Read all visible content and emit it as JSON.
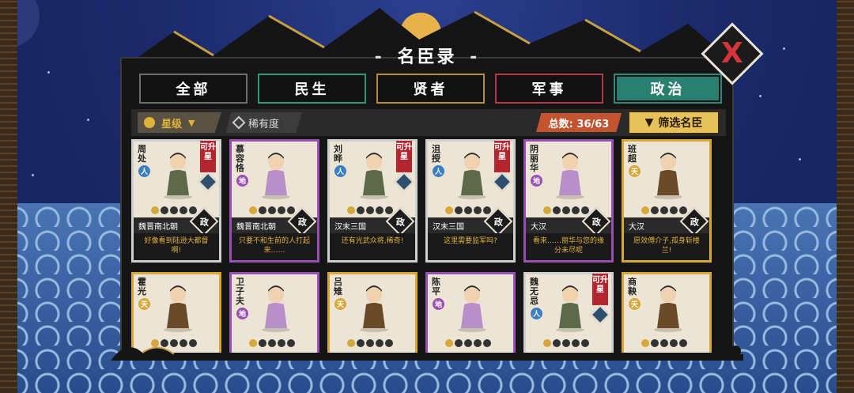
{
  "title": "名臣录",
  "title_dashes": [
    "-",
    "-"
  ],
  "close_label": "X",
  "tabs": [
    {
      "label": "全部",
      "kind": "all"
    },
    {
      "label": "民生",
      "kind": "min"
    },
    {
      "label": "贤者",
      "kind": "xian"
    },
    {
      "label": "军事",
      "kind": "jun"
    },
    {
      "label": "政治",
      "kind": "zheng",
      "active": true
    }
  ],
  "filters": {
    "star_label": "星级",
    "rarity_label": "稀有度",
    "total_text": "总数: 36/63",
    "filter_button": "筛选名臣"
  },
  "cards": [
    {
      "name": "周处",
      "tier": "人",
      "tier_class": "ren",
      "upgrade": "可升星",
      "era": "魏晋南北朝",
      "role": "政",
      "quote": "好像看到陆逊大都督啊!",
      "stars_on": 1
    },
    {
      "name": "慕容恪",
      "tier": "地",
      "tier_class": "di",
      "upgrade": "",
      "era": "魏晋南北朝",
      "role": "政",
      "quote": "只要不和生前的人打起来……",
      "stars_on": 1
    },
    {
      "name": "刘晔",
      "tier": "人",
      "tier_class": "ren",
      "upgrade": "可升星",
      "era": "汉末三国",
      "role": "政",
      "quote": "还有光武众将,稀奇!",
      "stars_on": 1
    },
    {
      "name": "沮授",
      "tier": "人",
      "tier_class": "ren",
      "upgrade": "可升星",
      "era": "汉末三国",
      "role": "政",
      "quote": "这里需要监军吗?",
      "stars_on": 1
    },
    {
      "name": "阴丽华",
      "tier": "地",
      "tier_class": "di",
      "upgrade": "",
      "era": "大汉",
      "role": "政",
      "quote": "看来……丽华与您的缘分未尽呢",
      "stars_on": 1
    },
    {
      "name": "班超",
      "tier": "天",
      "tier_class": "tian",
      "upgrade": "",
      "era": "大汉",
      "role": "政",
      "quote": "愿效傅介子,孤身斩楼兰!",
      "stars_on": 1
    },
    {
      "name": "霍光",
      "tier": "天",
      "tier_class": "tian",
      "upgrade": "",
      "era": "",
      "role": "",
      "quote": "",
      "stars_on": 1
    },
    {
      "name": "卫子夫",
      "tier": "地",
      "tier_class": "di",
      "upgrade": "",
      "era": "",
      "role": "",
      "quote": "",
      "stars_on": 1
    },
    {
      "name": "吕雉",
      "tier": "天",
      "tier_class": "tian",
      "upgrade": "",
      "era": "",
      "role": "",
      "quote": "",
      "stars_on": 1
    },
    {
      "name": "陈平",
      "tier": "地",
      "tier_class": "di",
      "upgrade": "",
      "era": "",
      "role": "",
      "quote": "",
      "stars_on": 1
    },
    {
      "name": "魏无忌",
      "tier": "人",
      "tier_class": "ren",
      "upgrade": "可升星",
      "era": "",
      "role": "",
      "quote": "",
      "stars_on": 1
    },
    {
      "name": "商鞅",
      "tier": "天",
      "tier_class": "tian",
      "upgrade": "",
      "era": "",
      "role": "",
      "quote": "",
      "stars_on": 1
    }
  ],
  "colors": {
    "accent_gold": "#e0b23a",
    "politics_tab": "#2a8070",
    "upgrade_red": "#b3262f",
    "total_orange": "#c4532f"
  }
}
